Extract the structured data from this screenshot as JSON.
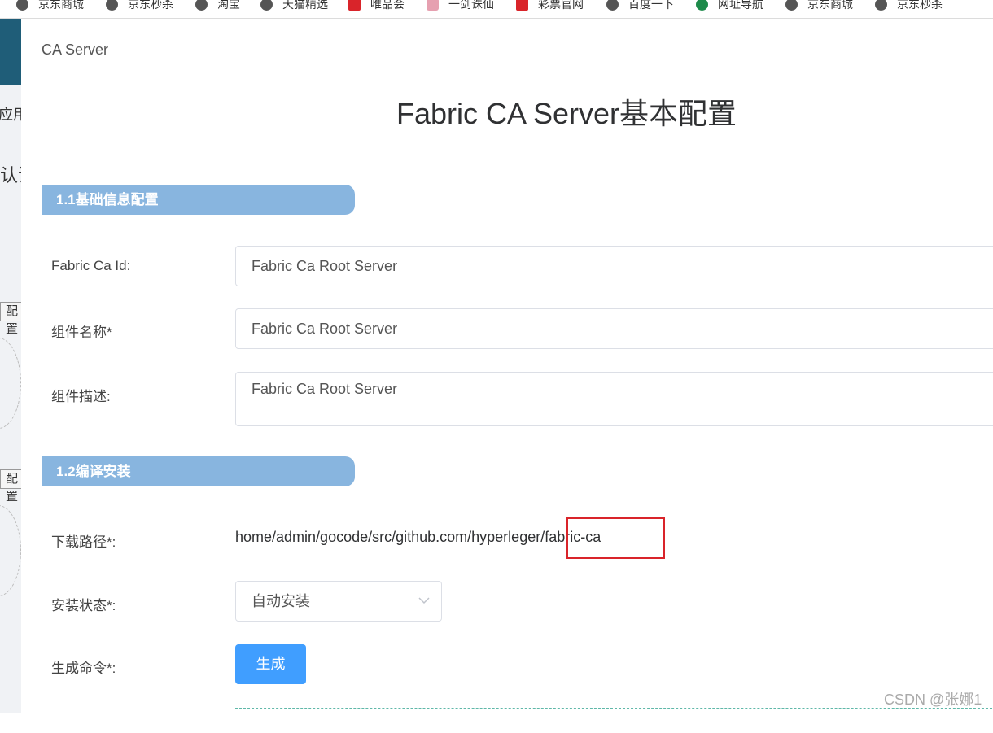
{
  "bookmarks": [
    "京东商城",
    "京东秒杀",
    "淘宝",
    "天猫精选",
    "唯品会",
    "一剑诛仙",
    "彩票官网",
    "百度一下",
    "网址导航",
    "京东商城",
    "京东秒杀"
  ],
  "background_app": {
    "text_yingyong": "应用",
    "text_ren": "认证",
    "box_1": "配置",
    "box_2": "配置"
  },
  "drawer": {
    "title": "CA Server",
    "heading": "Fabric CA Server基本配置"
  },
  "sections": {
    "basic": "1.1基础信息配置",
    "install": "1.2编译安装"
  },
  "form": {
    "fabric_ca_id_label": "Fabric Ca Id:",
    "fabric_ca_id_value": "Fabric Ca Root Server",
    "component_name_label": "组件名称*",
    "component_name_value": "Fabric Ca Root Server",
    "component_desc_label": "组件描述:",
    "component_desc_value": "Fabric Ca Root Server",
    "download_path_label": "下载路径*:",
    "download_path_value": "home/admin/gocode/src/github.com/hyperleger/fabric-ca",
    "install_status_label": "安装状态*:",
    "install_status_value": "自动安装",
    "generate_cmd_label": "生成命令*:",
    "generate_button": "生成"
  },
  "watermark": "CSDN @张娜1",
  "colors": {
    "section_bg": "#88b5df",
    "primary_button": "#409eff",
    "highlight_box": "#d9242a"
  }
}
